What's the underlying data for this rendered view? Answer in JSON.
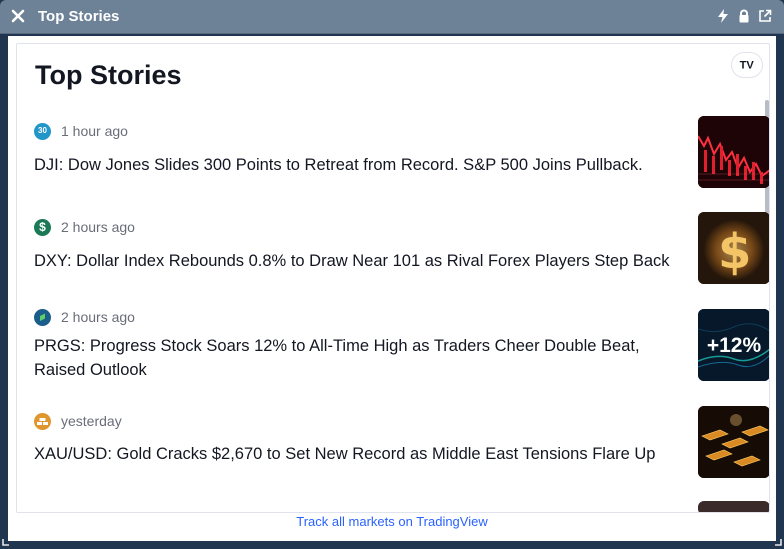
{
  "window": {
    "title": "Top Stories"
  },
  "widget": {
    "heading": "Top Stories",
    "footer_link": "Track all markets on TradingView"
  },
  "stories": [
    {
      "source_icon": "dow-30-icon",
      "icon_text": "30",
      "time": "1 hour ago",
      "headline": "DJI: Dow Jones Slides 300 Points to Retreat from Record. S&P 500 Joins Pullback."
    },
    {
      "source_icon": "dollar-icon",
      "icon_text": "$",
      "time": "2 hours ago",
      "headline": "DXY: Dollar Index Rebounds 0.8% to Draw Near 101 as Rival Forex Players Step Back"
    },
    {
      "source_icon": "progress-logo-icon",
      "icon_text": "",
      "time": "2 hours ago",
      "headline": "PRGS: Progress Stock Soars 12% to All-Time High as Traders Cheer Double Beat, Raised Outlook",
      "thumb_text": "+12%"
    },
    {
      "source_icon": "gold-bars-icon",
      "icon_text": "",
      "time": "yesterday",
      "headline": "XAU/USD: Gold Cracks $2,670 to Set New Record as Middle East Tensions Flare Up"
    }
  ],
  "colors": {
    "titlebar": "#6d8297",
    "link": "#2962ff",
    "text": "#131722",
    "muted": "#6a6d78"
  }
}
